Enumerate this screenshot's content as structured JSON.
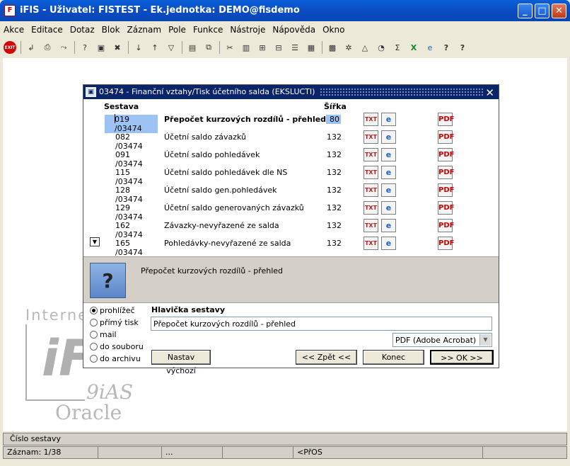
{
  "window": {
    "app_icon": "fis-app-icon",
    "title": "iFIS - Uživatel: FISTEST - Ek.jednotka: DEMO@fisdemo",
    "buttons": [
      "_",
      "□",
      "✕"
    ]
  },
  "menu": [
    "Akce",
    "Editace",
    "Dotaz",
    "Blok",
    "Záznam",
    "Pole",
    "Funkce",
    "Nástroje",
    "Nápověda",
    "Okno"
  ],
  "toolbar": {
    "exit_label": "EXIT",
    "icons": [
      "save-icon",
      "print-icon",
      "clear-icon",
      "enter-query-icon",
      "execute-query-icon",
      "cancel-query-icon",
      "sort-asc-icon",
      "sort-desc-icon",
      "filter-icon",
      "print-preview-icon",
      "copy-icon",
      "cut-icon",
      "paste-icon",
      "insert-record-icon",
      "delete-record-icon",
      "list-icon",
      "calculator-icon",
      "settings-icon",
      "chart-icon",
      "clock-icon",
      "sum-icon",
      "excel-icon",
      "globe-icon",
      "help-icon",
      "context-help-icon"
    ]
  },
  "watermark": {
    "line1": "Interne",
    "logo": "iF",
    "line2": "9iAS",
    "line3": "Oracle"
  },
  "dialog": {
    "title": "03474 - Finanční vztahy/Tisk účetního salda (EKSLUCTI)",
    "close_label": "✕",
    "col_report": "Sestava",
    "col_width": "Šířka",
    "rows": [
      {
        "code": "019 /03474",
        "name": "Přepočet kurzových rozdílů - přehled",
        "width": "80",
        "txt": "TXT",
        "ie": "e",
        "pdf": "PDF"
      },
      {
        "code": "082 /03474",
        "name": "Účetní saldo závazků",
        "width": "132",
        "txt": "TXT",
        "ie": "e",
        "pdf": "PDF"
      },
      {
        "code": "091 /03474",
        "name": "Účetní saldo pohledávek",
        "width": "132",
        "txt": "TXT",
        "ie": "e",
        "pdf": "PDF"
      },
      {
        "code": "115 /03474",
        "name": "Účetní saldo pohledávek dle NS",
        "width": "132",
        "txt": "TXT",
        "ie": "e",
        "pdf": "PDF"
      },
      {
        "code": "128 /03474",
        "name": "Účetní saldo gen.pohledávek",
        "width": "132",
        "txt": "TXT",
        "ie": "e",
        "pdf": "PDF"
      },
      {
        "code": "129 /03474",
        "name": "Účetní saldo generovaných závazků",
        "width": "132",
        "txt": "TXT",
        "ie": "e",
        "pdf": "PDF"
      },
      {
        "code": "162 /03474",
        "name": "Závazky-nevyřazené ze salda",
        "width": "132",
        "txt": "TXT",
        "ie": "e",
        "pdf": "PDF"
      },
      {
        "code": "165 /03474",
        "name": "Pohledávky-nevyřazené ze salda",
        "width": "132",
        "txt": "TXT",
        "ie": "e",
        "pdf": "PDF"
      }
    ],
    "info_text": "Přepočet kurzových rozdílů - přehled",
    "output_options": [
      "prohlížeč",
      "přímý tisk",
      "mail",
      "do souboru",
      "do archivu"
    ],
    "selected_output": "prohlížeč",
    "header_label": "Hlavička sestavy",
    "header_value": "Přepočet kurzových rozdílů - přehled",
    "format_selected": "PDF (Adobe Acrobat)",
    "btn_defaults": "Nastav výchozí",
    "btn_back": "<< Zpět <<",
    "btn_end": "Konec",
    "btn_ok": ">> OK >>"
  },
  "status": {
    "hint": "Číslo sestavy",
    "record": "Záznam: 1/38",
    "cell2": "",
    "cell3": "...",
    "cell4": "",
    "cell5": "<PřOS",
    "cell6": ""
  }
}
